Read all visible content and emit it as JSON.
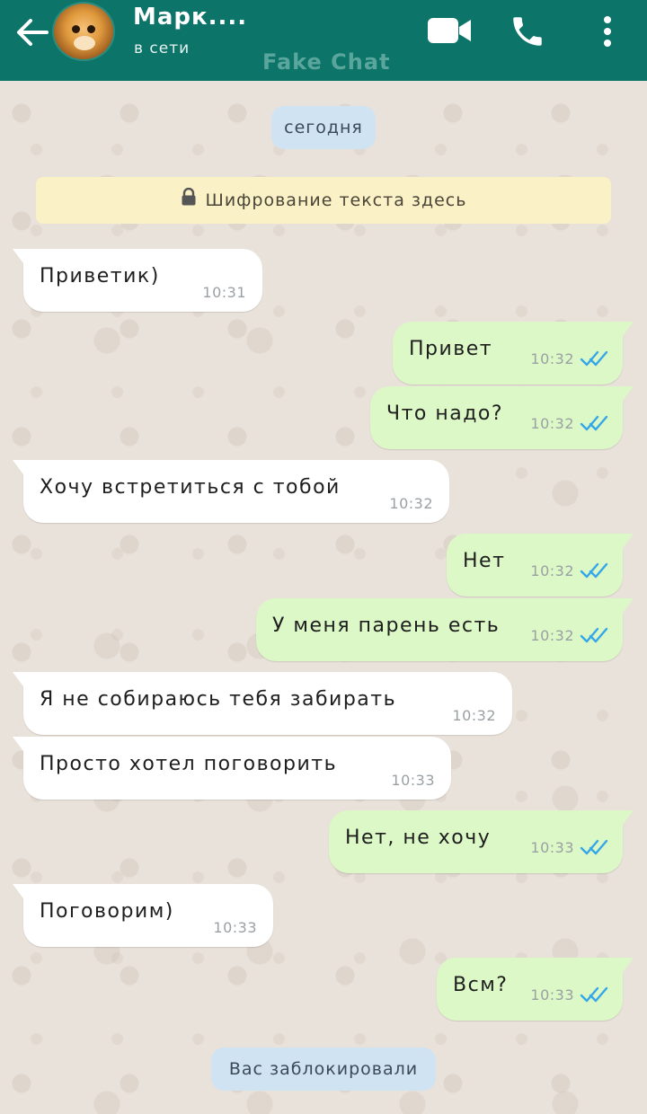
{
  "header": {
    "contact_name": "Марк....",
    "status": "в сети",
    "watermark": "Fake Chat",
    "bg_color": "#0c7468"
  },
  "date_label": "сегодня",
  "encryption_notice": "Шифрование текста здесь",
  "messages": [
    {
      "dir": "in",
      "text": "Приветик)",
      "time": "10:31"
    },
    {
      "dir": "out",
      "text": "Привет",
      "time": "10:32",
      "read": true
    },
    {
      "dir": "out",
      "text": "Что надо?",
      "time": "10:32",
      "read": true
    },
    {
      "dir": "in",
      "text": "Хочу встретиться с тобой",
      "time": "10:32"
    },
    {
      "dir": "out",
      "text": "Нет",
      "time": "10:32",
      "read": true
    },
    {
      "dir": "out",
      "text": "У меня парень есть",
      "time": "10:32",
      "read": true
    },
    {
      "dir": "in",
      "text": "Я не собираюсь тебя забирать",
      "time": "10:32"
    },
    {
      "dir": "in",
      "text": "Просто хотел поговорить",
      "time": "10:33"
    },
    {
      "dir": "out",
      "text": "Нет, не хочу",
      "time": "10:33",
      "read": true
    },
    {
      "dir": "in",
      "text": "Поговорим)",
      "time": "10:33"
    },
    {
      "dir": "out",
      "text": "Всм?",
      "time": "10:33",
      "read": true
    }
  ],
  "blocked_notice": "Вас заблокировали",
  "icons": {
    "back": "arrow-left-icon",
    "video": "video-camera-icon",
    "call": "phone-icon",
    "menu": "more-vertical-icon",
    "lock": "lock-icon",
    "read": "double-check-icon"
  },
  "colors": {
    "incoming_bubble": "#ffffff",
    "outgoing_bubble": "#dcf8c6",
    "read_ticks": "#34a7e8",
    "date_pill": "#cfe3f2",
    "encryption_banner": "#fbf1c6"
  }
}
